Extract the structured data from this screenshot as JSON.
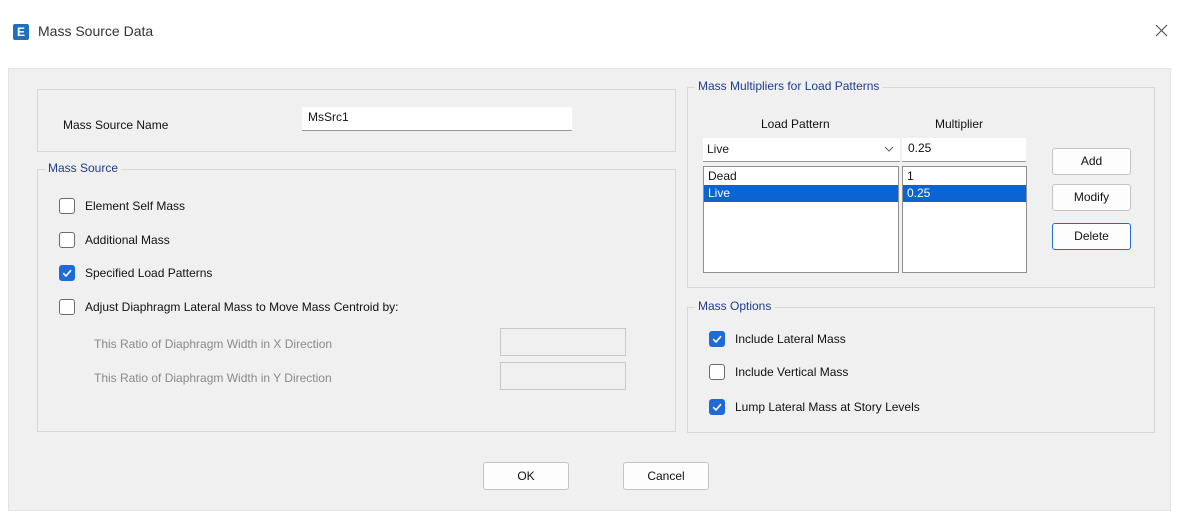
{
  "window": {
    "title": "Mass Source Data",
    "icon_letter": "E"
  },
  "name_section": {
    "label": "Mass Source Name",
    "value": "MsSrc1"
  },
  "mass_source": {
    "title": "Mass Source",
    "options": [
      {
        "label": "Element Self Mass",
        "checked": false
      },
      {
        "label": "Additional Mass",
        "checked": false
      },
      {
        "label": "Specified Load Patterns",
        "checked": true
      },
      {
        "label": "Adjust Diaphragm Lateral Mass to Move Mass Centroid by:",
        "checked": false
      }
    ],
    "ratio_x_label": "This Ratio of Diaphragm Width in X Direction",
    "ratio_x_value": "",
    "ratio_y_label": "This Ratio of Diaphragm Width in Y Direction",
    "ratio_y_value": ""
  },
  "multipliers": {
    "title": "Mass Multipliers for Load Patterns",
    "col_pattern": "Load Pattern",
    "col_multiplier": "Multiplier",
    "selected_pattern": "Live",
    "multiplier_value": "0.25",
    "rows": [
      {
        "pattern": "Dead",
        "multiplier": "1",
        "selected": false
      },
      {
        "pattern": "Live",
        "multiplier": "0.25",
        "selected": true
      }
    ],
    "add_label": "Add",
    "modify_label": "Modify",
    "delete_label": "Delete"
  },
  "mass_options": {
    "title": "Mass Options",
    "options": [
      {
        "label": "Include Lateral Mass",
        "checked": true
      },
      {
        "label": "Include Vertical Mass",
        "checked": false
      },
      {
        "label": "Lump Lateral Mass at Story Levels",
        "checked": true
      }
    ]
  },
  "footer": {
    "ok_label": "OK",
    "cancel_label": "Cancel"
  },
  "colors": {
    "accent": "#1d6ad8",
    "selection": "#0a64d1",
    "group_title": "#1e3c8c"
  },
  "icons": {
    "close": "close-icon",
    "checkmark": "checkmark-icon",
    "dropdown": "chevron-down-icon",
    "app": "etabs-app-icon"
  }
}
